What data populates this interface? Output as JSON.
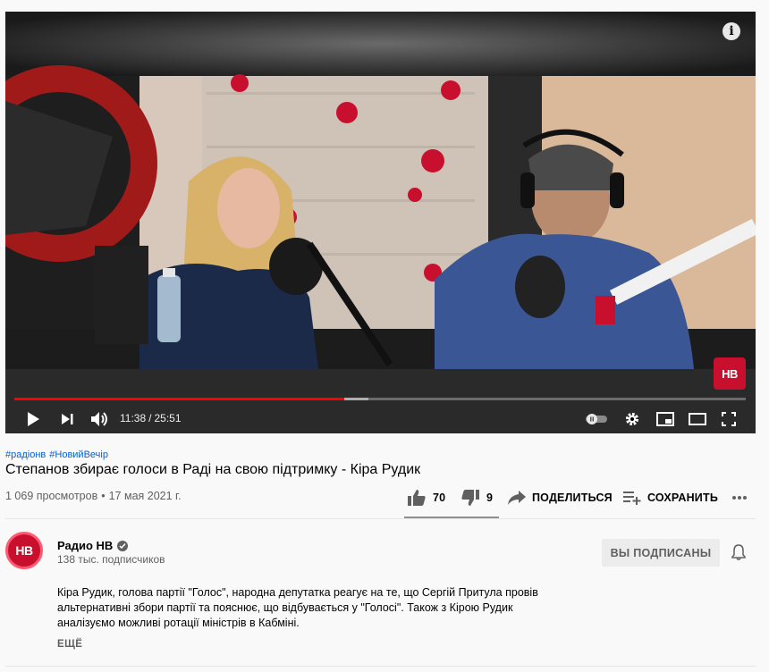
{
  "player": {
    "info_icon": "i",
    "watermark": "НВ",
    "progress": {
      "played_fraction": 0.4506,
      "buffered_fraction": 0.4847
    },
    "time_current": "11:38",
    "time_separator": "/",
    "time_total": "25:51",
    "icons": [
      "play-icon",
      "next-icon",
      "volume-icon",
      "autoplay-toggle-icon",
      "settings-gear-icon",
      "miniplayer-icon",
      "theater-mode-icon",
      "fullscreen-icon"
    ]
  },
  "video": {
    "hashtags": [
      "#радіонв",
      "#НовийВечір"
    ],
    "title": "Степанов збирає голоси в Раді на свою підтримку - Кіра Рудик",
    "views": "1 069 просмотров",
    "date": "17 мая 2021 г.",
    "dot": "•"
  },
  "actions": {
    "likes": "70",
    "dislikes": "9",
    "share_label": "ПОДЕЛИТЬСЯ",
    "save_label": "СОХРАНИТЬ"
  },
  "channel": {
    "avatar_text": "НВ",
    "name": "Радио НВ",
    "subscribers": "138 тыс. подписчиков",
    "subscribe_label": "ВЫ ПОДПИСАНЫ"
  },
  "description": {
    "lines": [
      "Кіра Рудик,  голова партії \"Голос\", народна депутатка реагує на те, що Сергій Притула провів",
      "альтернативні збори партії та пояснює, що відбувається у \"Голосі\". Також з Кірою Рудик",
      "аналізуємо можливі ротації міністрів в Кабміні."
    ],
    "more_label": "ЕЩЁ"
  },
  "colors": {
    "progress_played": "#ff0000",
    "link": "#065fd4",
    "brand_red": "#c8102e"
  }
}
